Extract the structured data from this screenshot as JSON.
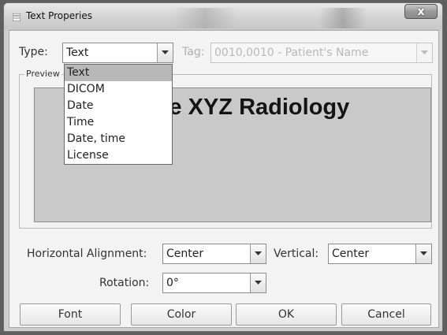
{
  "window": {
    "title": "Text Properies",
    "close_label": "x"
  },
  "form": {
    "type_label": "Type:",
    "type_value": "Text",
    "tag_label": "Tag:",
    "tag_value": "0010,0010 - Patient's Name",
    "preview_label": "Preview",
    "preview_text": "Image XYZ Radiology",
    "halign_label": "Horizontal Alignment:",
    "halign_value": "Center",
    "valign_label": "Vertical:",
    "valign_value": "Center",
    "rotation_label": "Rotation:",
    "rotation_value": "0°"
  },
  "type_dropdown": {
    "options": [
      "Text",
      "DICOM",
      "Date",
      "Time",
      "Date, time",
      "License"
    ],
    "selected": "Text"
  },
  "buttons": {
    "font": "Font",
    "color": "Color",
    "ok": "OK",
    "cancel": "Cancel"
  },
  "icons": {
    "app": "window-icon",
    "close": "close-icon",
    "combo_arrow": "chevron-down-icon"
  },
  "colors": {
    "client_bg": "#f3f3f3",
    "preview_bg": "#c9c9c9",
    "selected_item_bg": "#b8b8b8"
  }
}
